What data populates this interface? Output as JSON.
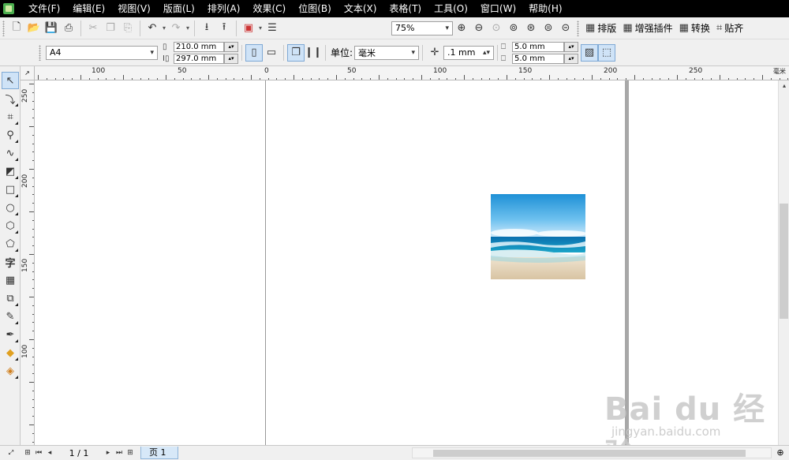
{
  "menubar": {
    "items": [
      "文件(F)",
      "编辑(E)",
      "视图(V)",
      "版面(L)",
      "排列(A)",
      "效果(C)",
      "位图(B)",
      "文本(X)",
      "表格(T)",
      "工具(O)",
      "窗口(W)",
      "帮助(H)"
    ]
  },
  "toolbar": {
    "zoom_value": "75%",
    "buttons": {
      "layout": "排版",
      "plugins": "增强插件",
      "convert": "转换",
      "paste": "贴齐"
    }
  },
  "property_bar": {
    "paper_size": "A4",
    "width": "210.0 mm",
    "height": "297.0 mm",
    "unit_label": "单位:",
    "unit_value": "毫米",
    "nudge": ".1 mm",
    "dup_x": "5.0 mm",
    "dup_y": "5.0 mm"
  },
  "ruler": {
    "corner_unit": "毫米",
    "h_labels": [
      "100",
      "50",
      "0",
      "50",
      "100",
      "150",
      "200",
      "250"
    ],
    "right_unit": "毫米",
    "v_labels": [
      "250",
      "200",
      "150",
      "100"
    ]
  },
  "status": {
    "page_count": "1 / 1",
    "page_tab": "页 1"
  },
  "watermark": {
    "logo": "Bai du 经验",
    "url": "jingyan.baidu.com"
  },
  "colors": {
    "menubar_bg": "#000000",
    "selected_tool": "#cfe3f7",
    "photo_sky": "#2a9ed8",
    "photo_sand": "#e6d6bd"
  }
}
